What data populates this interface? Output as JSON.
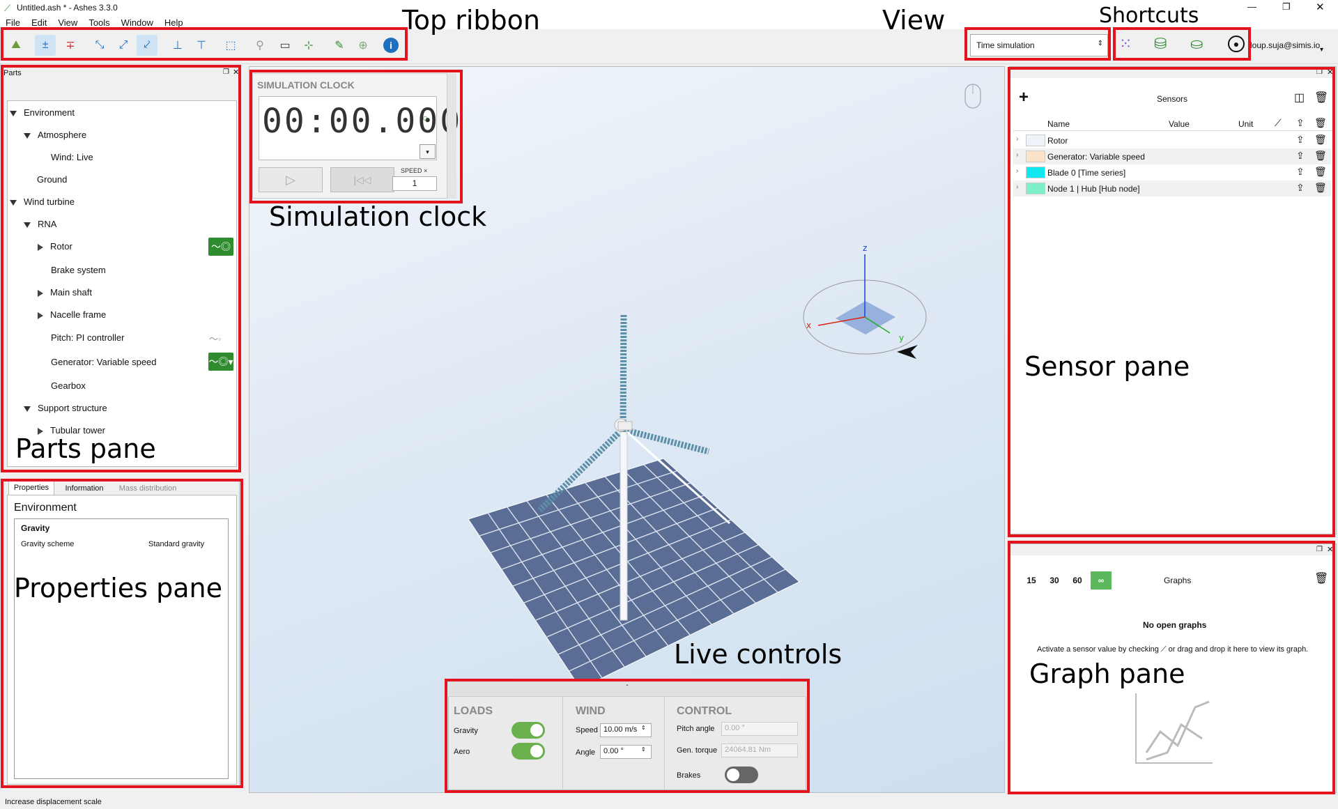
{
  "window": {
    "title": "Untitled.ash * - Ashes 3.3.0"
  },
  "menu": [
    "File",
    "Edit",
    "View",
    "Tools",
    "Window",
    "Help"
  ],
  "toolbar": {
    "view_select": "Time simulation",
    "user": "loup.suja@simis.io"
  },
  "annotations": {
    "top_ribbon": "Top ribbon",
    "view": "View",
    "shortcuts": "Shortcuts",
    "simulation_clock": "Simulation clock",
    "parts_pane": "Parts pane",
    "properties_pane": "Properties pane",
    "live_controls": "Live controls",
    "sensor_pane": "Sensor pane",
    "graph_pane": "Graph pane"
  },
  "parts": {
    "title": "Parts",
    "items": [
      "Environment",
      "Atmosphere",
      "Wind: Live",
      "Ground",
      "Wind turbine",
      "RNA",
      "Rotor",
      "Brake system",
      "Main shaft",
      "Nacelle frame",
      "Pitch: PI controller",
      "Generator: Variable speed",
      "Gearbox",
      "Support structure",
      "Tubular tower"
    ]
  },
  "properties": {
    "tabs": [
      "Properties",
      "Information",
      "Mass distribution"
    ],
    "heading": "Environment",
    "group": "Gravity",
    "key": "Gravity scheme",
    "value": "Standard gravity"
  },
  "clock": {
    "title": "SIMULATION CLOCK",
    "time": "00:00.000",
    "speed_label": "SPEED ×",
    "speed_value": "1"
  },
  "live": {
    "loads": {
      "title": "LOADS",
      "gravity": "Gravity",
      "aero": "Aero"
    },
    "wind": {
      "title": "WIND",
      "speed_label": "Speed",
      "speed": "10.00 m/s",
      "angle_label": "Angle",
      "angle": "0.00 °"
    },
    "control": {
      "title": "CONTROL",
      "pitch_label": "Pitch angle",
      "pitch": "0.00 °",
      "torque_label": "Gen. torque",
      "torque": "24064.81 Nm",
      "brakes": "Brakes"
    }
  },
  "sensors": {
    "title": "Sensors",
    "col_name": "Name",
    "col_value": "Value",
    "col_unit": "Unit",
    "rows": [
      {
        "name": "Rotor",
        "color": "#eef3fa"
      },
      {
        "name": "Generator: Variable speed",
        "color": "#fbe3c8"
      },
      {
        "name": "Blade 0 [Time series]",
        "color": "#10e8f0"
      },
      {
        "name": "Node 1 | Hub [Hub node]",
        "color": "#7ef0c8"
      }
    ]
  },
  "graphs": {
    "title": "Graphs",
    "ranges": [
      "15",
      "30",
      "60",
      "∞"
    ],
    "empty_title": "No open graphs",
    "empty_text": "Activate a sensor value by checking ⟋ or drag and drop it here to view its graph."
  },
  "axes": {
    "x": "x",
    "y": "y",
    "z": "z"
  },
  "status": "Increase displacement scale"
}
